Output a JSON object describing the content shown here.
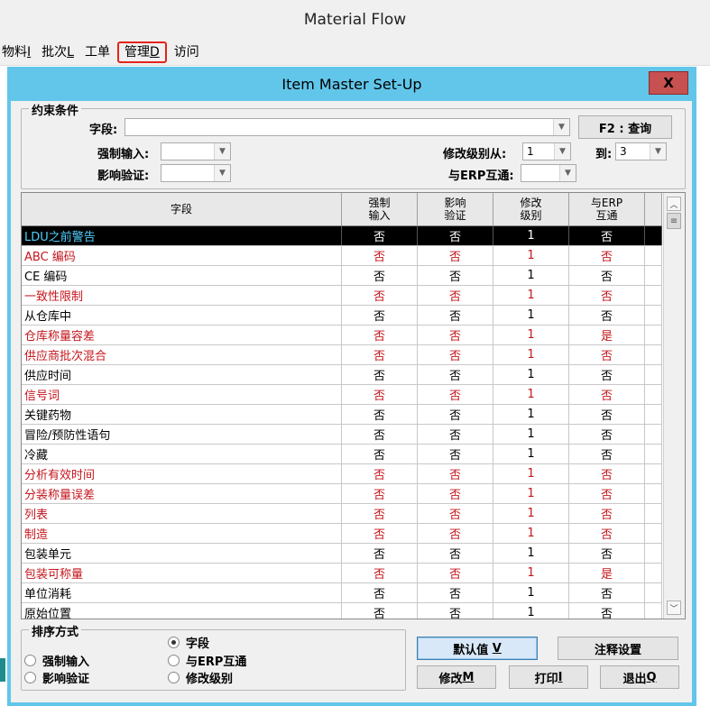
{
  "app": {
    "title": "Material Flow"
  },
  "menu": [
    {
      "label": "物料",
      "key": "I"
    },
    {
      "label": "批次",
      "key": "L"
    },
    {
      "label": "工单",
      "key": ""
    },
    {
      "label": "管理",
      "key": "D"
    },
    {
      "label": "访问",
      "key": ""
    }
  ],
  "dialog": {
    "title": "Item Master Set-Up",
    "close": "X"
  },
  "filter": {
    "group_label": "约束条件",
    "field_label": "字段:",
    "field_value": "",
    "query_button": "F2 : 查询",
    "mandatory_label": "强制输入:",
    "mandatory_value": "",
    "verify_label": "影响验证:",
    "verify_value": "",
    "level_from_label": "修改级别从:",
    "level_from_value": "1",
    "level_to_label": "到:",
    "level_to_value": "3",
    "erp_label": "与ERP互通:",
    "erp_value": ""
  },
  "grid": {
    "headers": [
      "字段",
      "强制\n输入",
      "影响\n验证",
      "修改\n级别",
      "与ERP\n互通"
    ],
    "rows": [
      {
        "name": "LDU之前警告",
        "mandatory": "否",
        "verify": "否",
        "level": "1",
        "erp": "否",
        "red": false,
        "selected": true
      },
      {
        "name": "ABC 编码",
        "mandatory": "否",
        "verify": "否",
        "level": "1",
        "erp": "否",
        "red": true,
        "selected": false
      },
      {
        "name": "CE 编码",
        "mandatory": "否",
        "verify": "否",
        "level": "1",
        "erp": "否",
        "red": false,
        "selected": false
      },
      {
        "name": "一致性限制",
        "mandatory": "否",
        "verify": "否",
        "level": "1",
        "erp": "否",
        "red": true,
        "selected": false
      },
      {
        "name": "从仓库中",
        "mandatory": "否",
        "verify": "否",
        "level": "1",
        "erp": "否",
        "red": false,
        "selected": false
      },
      {
        "name": "仓库称量容差",
        "mandatory": "否",
        "verify": "否",
        "level": "1",
        "erp": "是",
        "red": true,
        "selected": false
      },
      {
        "name": "供应商批次混合",
        "mandatory": "否",
        "verify": "否",
        "level": "1",
        "erp": "否",
        "red": true,
        "selected": false
      },
      {
        "name": "供应时间",
        "mandatory": "否",
        "verify": "否",
        "level": "1",
        "erp": "否",
        "red": false,
        "selected": false
      },
      {
        "name": "信号词",
        "mandatory": "否",
        "verify": "否",
        "level": "1",
        "erp": "否",
        "red": true,
        "selected": false
      },
      {
        "name": "关键药物",
        "mandatory": "否",
        "verify": "否",
        "level": "1",
        "erp": "否",
        "red": false,
        "selected": false
      },
      {
        "name": "冒险/预防性语句",
        "mandatory": "否",
        "verify": "否",
        "level": "1",
        "erp": "否",
        "red": false,
        "selected": false
      },
      {
        "name": "冷藏",
        "mandatory": "否",
        "verify": "否",
        "level": "1",
        "erp": "否",
        "red": false,
        "selected": false
      },
      {
        "name": "分析有效时间",
        "mandatory": "否",
        "verify": "否",
        "level": "1",
        "erp": "否",
        "red": true,
        "selected": false
      },
      {
        "name": "分装称量误差",
        "mandatory": "否",
        "verify": "否",
        "level": "1",
        "erp": "否",
        "red": true,
        "selected": false
      },
      {
        "name": "列表",
        "mandatory": "否",
        "verify": "否",
        "level": "1",
        "erp": "否",
        "red": true,
        "selected": false
      },
      {
        "name": "制造",
        "mandatory": "否",
        "verify": "否",
        "level": "1",
        "erp": "否",
        "red": true,
        "selected": false
      },
      {
        "name": "包装单元",
        "mandatory": "否",
        "verify": "否",
        "level": "1",
        "erp": "否",
        "red": false,
        "selected": false
      },
      {
        "name": "包装可称量",
        "mandatory": "否",
        "verify": "否",
        "level": "1",
        "erp": "是",
        "red": true,
        "selected": false
      },
      {
        "name": "单位消耗",
        "mandatory": "否",
        "verify": "否",
        "level": "1",
        "erp": "否",
        "red": false,
        "selected": false
      },
      {
        "name": "原始位置",
        "mandatory": "否",
        "verify": "否",
        "level": "1",
        "erp": "否",
        "red": false,
        "selected": false
      }
    ]
  },
  "sort": {
    "group_label": "排序方式",
    "options": [
      {
        "label": "字段",
        "checked": true
      },
      {
        "label": "强制输入",
        "checked": false
      },
      {
        "label": "与ERP互通",
        "checked": false
      },
      {
        "label": "影响验证",
        "checked": false
      },
      {
        "label": "修改级别",
        "checked": false
      }
    ]
  },
  "buttons": {
    "default_label": "默认值",
    "default_key": "V",
    "comment_settings": "注释设置",
    "modify_label": "修改",
    "modify_key": "M",
    "print_label": "打印",
    "print_key": "I",
    "exit_label": "退出",
    "exit_key": "Q"
  },
  "colors": {
    "dialog_frame": "#62c6ea",
    "red_text": "#c4161c",
    "selected_row": "#000000",
    "selected_name": "#4fd0ff",
    "highlight_border": "#e3241b",
    "close_button": "#c75050"
  },
  "icons": {
    "scroll_up": "chevron-up-icon",
    "scroll_down": "chevron-down-icon",
    "combo": "dropdown-arrow-icon"
  }
}
